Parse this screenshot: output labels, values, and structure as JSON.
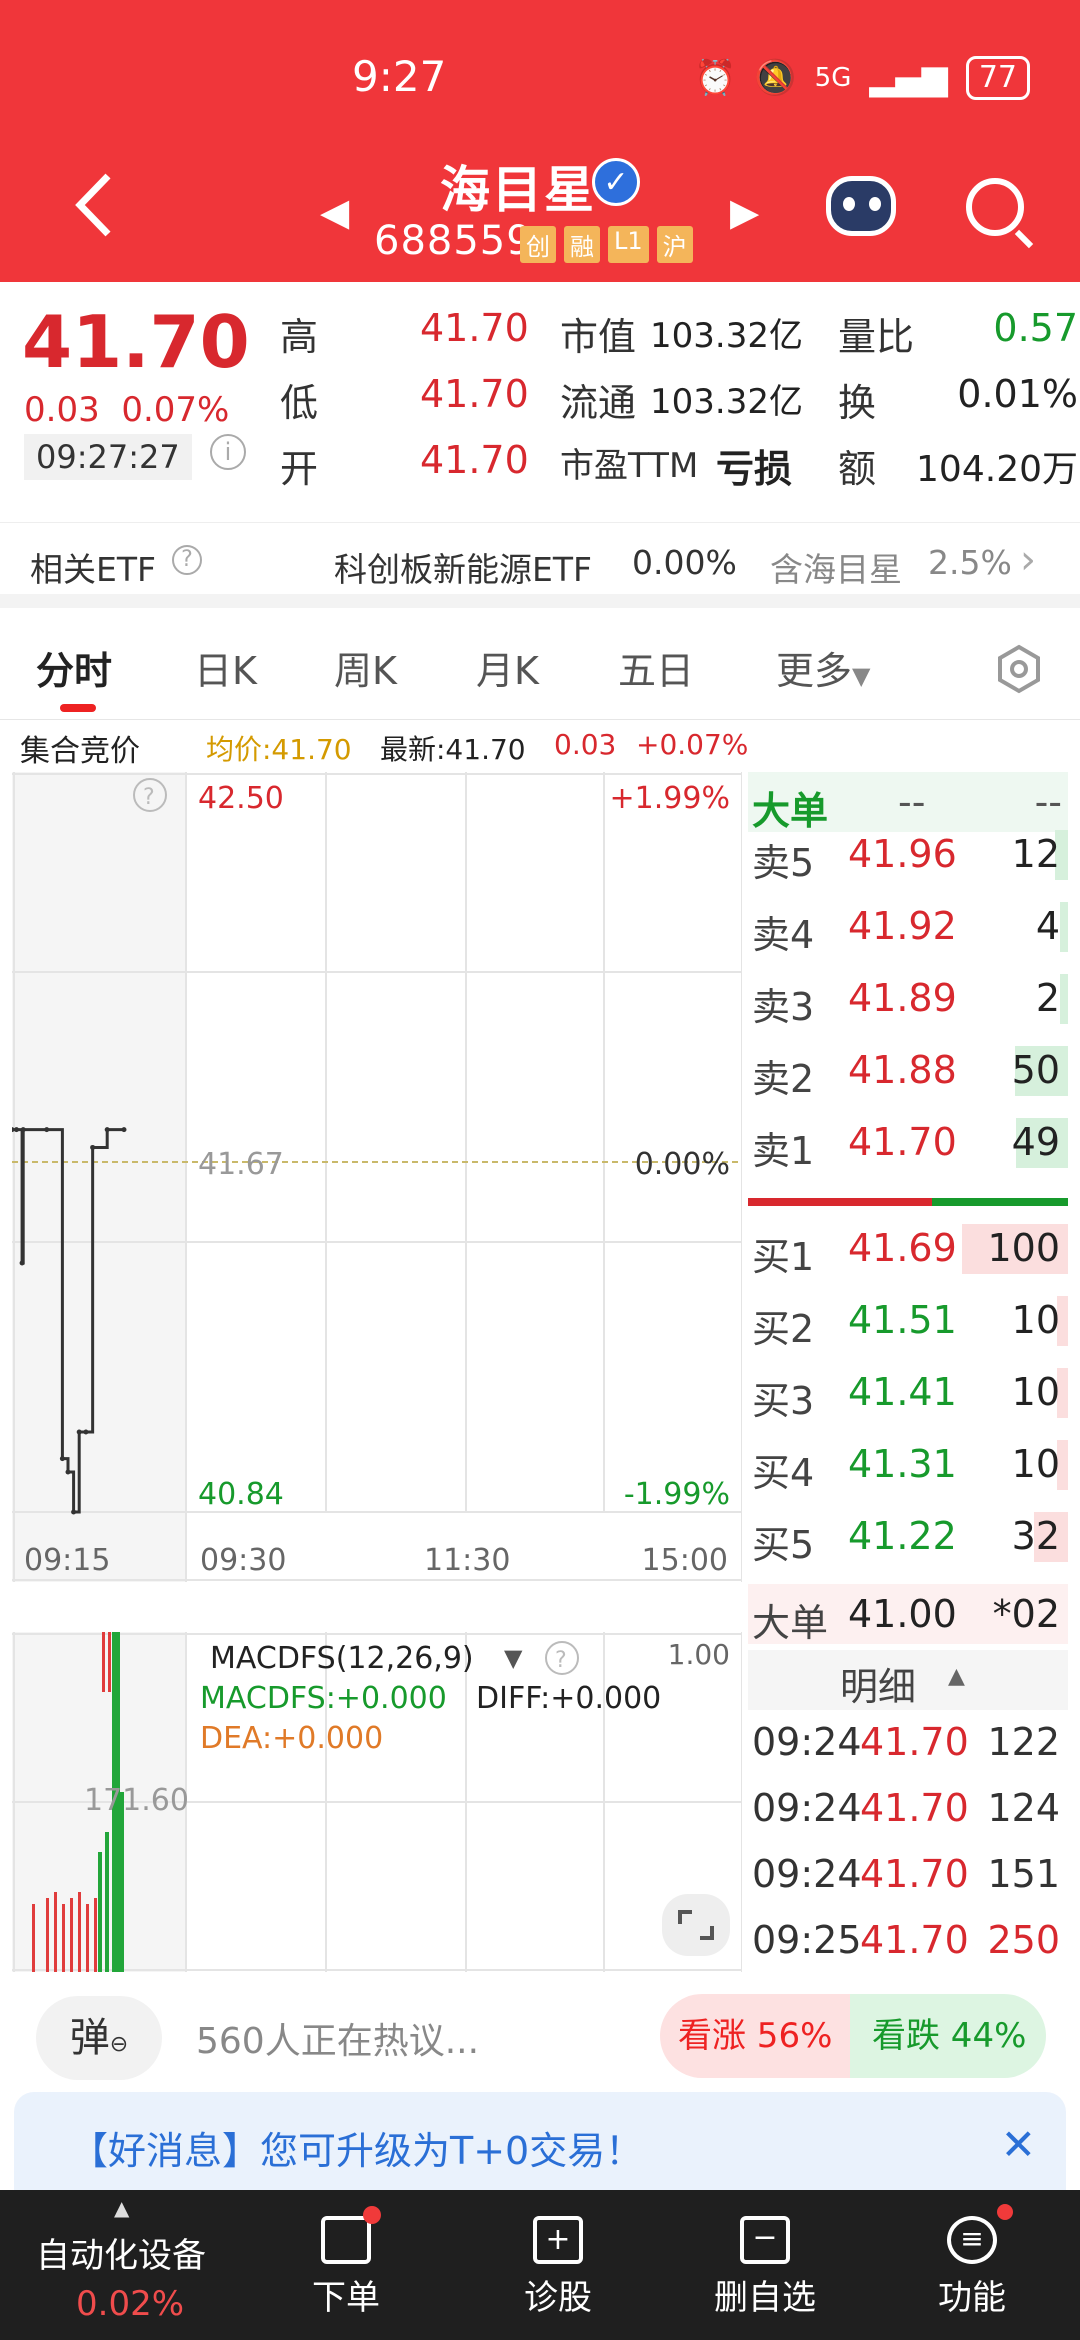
{
  "status": {
    "time": "9:27",
    "network": "5G",
    "battery": "77"
  },
  "header": {
    "stock_name": "海目星",
    "stock_code": "688559",
    "tags": [
      "创",
      "融",
      "L1",
      "沪"
    ]
  },
  "quote": {
    "last": "41.70",
    "change": "0.03",
    "change_pct": "0.07%",
    "time": "09:27:27",
    "rows": [
      {
        "l1": "高",
        "v1": "41.70",
        "l2": "市值",
        "v2": "103.32亿",
        "l3": "量比",
        "v3": "0.57"
      },
      {
        "l1": "低",
        "v1": "41.70",
        "l2": "流通",
        "v2": "103.32亿",
        "l3": "换",
        "v3": "0.01%"
      },
      {
        "l1": "开",
        "v1": "41.70",
        "l2": "市盈TTM",
        "v2": "亏损",
        "l3": "额",
        "v3": "104.20万"
      }
    ]
  },
  "etf": {
    "label": "相关ETF",
    "name": "科创板新能源ETF",
    "pct": "0.00%",
    "contain": "含海目星",
    "contain_pct": "2.5%"
  },
  "tabs": [
    "分时",
    "日K",
    "周K",
    "月K",
    "五日",
    "更多"
  ],
  "summary": {
    "phase": "集合竞价",
    "avg": "均价:41.70",
    "latest": "最新:41.70",
    "chg": "0.03",
    "chg_pct": "+0.07%"
  },
  "chart": {
    "y_top": "42.50",
    "y_mid": "41.67",
    "y_bot": "40.84",
    "pct_top": "+1.99%",
    "pct_mid": "0.00%",
    "pct_bot": "-1.99%",
    "x_labels": [
      "09:15",
      "09:30",
      "11:30",
      "15:00"
    ]
  },
  "chart_data": {
    "type": "line",
    "title": "",
    "x": [
      0,
      0.04,
      0.09,
      0.1,
      0.31,
      0.45,
      0.5,
      0.55,
      0.6,
      0.66,
      0.72,
      0.85,
      1.0
    ],
    "values": [
      41.7,
      41.7,
      41.4,
      41.7,
      41.7,
      40.96,
      40.93,
      40.84,
      41.02,
      41.02,
      41.66,
      41.7,
      41.7
    ],
    "ylim": [
      40.84,
      42.5
    ],
    "xlabel": "",
    "ylabel": ""
  },
  "orderbook": {
    "big_label": "大单",
    "big_v1": "--",
    "big_v2": "--",
    "asks": [
      {
        "label": "卖5",
        "price": "41.96",
        "vol": "12"
      },
      {
        "label": "卖4",
        "price": "41.92",
        "vol": "4"
      },
      {
        "label": "卖3",
        "price": "41.89",
        "vol": "2"
      },
      {
        "label": "卖2",
        "price": "41.88",
        "vol": "50"
      },
      {
        "label": "卖1",
        "price": "41.70",
        "vol": "49"
      }
    ],
    "bids": [
      {
        "label": "买1",
        "price": "41.69",
        "vol": "100"
      },
      {
        "label": "买2",
        "price": "41.51",
        "vol": "10"
      },
      {
        "label": "买3",
        "price": "41.41",
        "vol": "10"
      },
      {
        "label": "买4",
        "price": "41.31",
        "vol": "10"
      },
      {
        "label": "买5",
        "price": "41.22",
        "vol": "32"
      }
    ],
    "big2_label": "大单",
    "big2_price": "41.00",
    "big2_vol": "*02",
    "detail_label": "明细",
    "trades": [
      {
        "t": "09:24",
        "p": "41.70",
        "v": "122"
      },
      {
        "t": "09:24",
        "p": "41.70",
        "v": "124"
      },
      {
        "t": "09:24",
        "p": "41.70",
        "v": "151"
      },
      {
        "t": "09:25",
        "p": "41.70",
        "v": "250"
      }
    ]
  },
  "macd": {
    "title": "MACDFS(12,26,9)",
    "macdfs": "MACDFS:+0.000",
    "diff": "DIFF:+0.000",
    "dea": "DEA:+0.000",
    "top": "1.00",
    "vol_label": "171.60"
  },
  "social": {
    "danmu": "弹",
    "hot": "560人正在热议...",
    "bull": "看涨 56%",
    "bear": "看跌 44%"
  },
  "news": {
    "text": "【好消息】您可升级为T+0交易！"
  },
  "bottom": {
    "sector": "自动化设备",
    "sector_pct": "0.02%",
    "items": [
      "下单",
      "诊股",
      "删自选",
      "功能"
    ]
  }
}
